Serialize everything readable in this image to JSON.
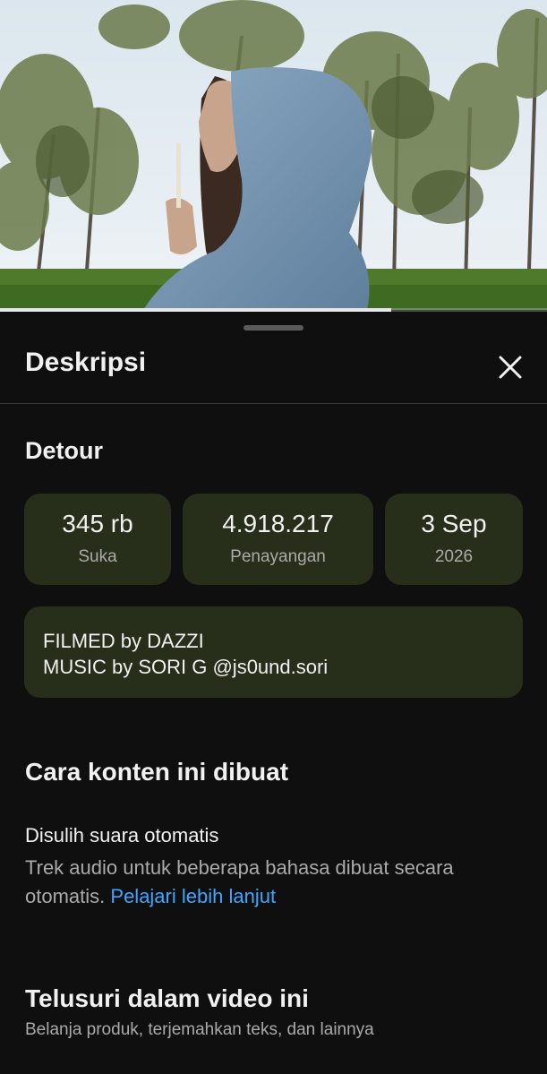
{
  "player": {
    "progress": 0.716
  },
  "sheet": {
    "title": "Deskripsi",
    "close_icon": "close-icon"
  },
  "video": {
    "title": "Detour",
    "stats": {
      "likes_value": "345 rb",
      "likes_label": "Suka",
      "views_value": "4.918.217",
      "views_label": "Penayangan",
      "date_value": "3 Sep",
      "date_label": "2026"
    },
    "description": {
      "line1": "FILMED by DAZZI",
      "line2": "MUSIC by SORI G @js0und.sori"
    }
  },
  "how_made": {
    "heading": "Cara konten ini dibuat",
    "item_title": "Disulih suara otomatis",
    "item_desc": "Trek audio untuk beberapa bahasa dibuat secara otomatis.",
    "link": "Pelajari lebih lanjut"
  },
  "explore": {
    "heading": "Telusuri dalam video ini",
    "subtitle": "Belanja produk, terjemahkan teks, dan lainnya"
  },
  "colors": {
    "background": "#0f0f0f",
    "card": "#272e1a",
    "link": "#3ea6ff",
    "secondary_text": "#aaaaaa"
  }
}
